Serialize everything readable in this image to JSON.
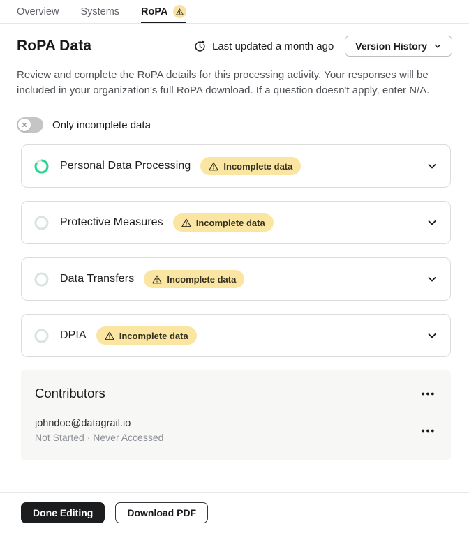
{
  "tab_bar": {
    "tabs": [
      {
        "label": "Overview",
        "active": false
      },
      {
        "label": "Systems",
        "active": false
      },
      {
        "label": "RoPA",
        "active": true,
        "has_warning": true
      }
    ]
  },
  "header": {
    "title": "RoPA Data",
    "last_updated": "Last updated a month ago",
    "version_history_label": "Version History"
  },
  "description": "Review and complete the RoPA details for this processing activity. Your responses will be included in your organization's full RoPA download. If a question doesn't apply, enter N/A.",
  "filter_toggle": {
    "label": "Only incomplete data",
    "state": "off"
  },
  "sections": [
    {
      "title": "Personal Data Processing",
      "badge": "Incomplete data",
      "progress_percent": 85
    },
    {
      "title": "Protective Measures",
      "badge": "Incomplete data",
      "progress_percent": 0
    },
    {
      "title": "Data Transfers",
      "badge": "Incomplete data",
      "progress_percent": 0
    },
    {
      "title": "DPIA",
      "badge": "Incomplete data",
      "progress_percent": 0
    }
  ],
  "contributors": {
    "title": "Contributors",
    "items": [
      {
        "email": "johndoe@datagrail.io",
        "status": "Not Started · Never Accessed"
      }
    ]
  },
  "footer": {
    "done_label": "Done Editing",
    "download_label": "Download PDF"
  },
  "icons": {
    "tab_warning": "warning-triangle-icon",
    "last_updated": "history-clock-icon",
    "version_history": "chevron-down-icon",
    "toggle_off": "x-icon",
    "badge": "warning-triangle-icon",
    "section_expand": "chevron-down-icon",
    "menu": "ellipsis-icon"
  },
  "colors": {
    "progress_green": "#2bd390",
    "ring_empty": "#d9e4de",
    "badge_bg": "#fbe5a3",
    "badge_text": "#33301f",
    "warning_circle_bg": "#f9e2a4",
    "dark_button_bg": "#1b1d1f",
    "panel_bg": "#f7f7f6"
  }
}
